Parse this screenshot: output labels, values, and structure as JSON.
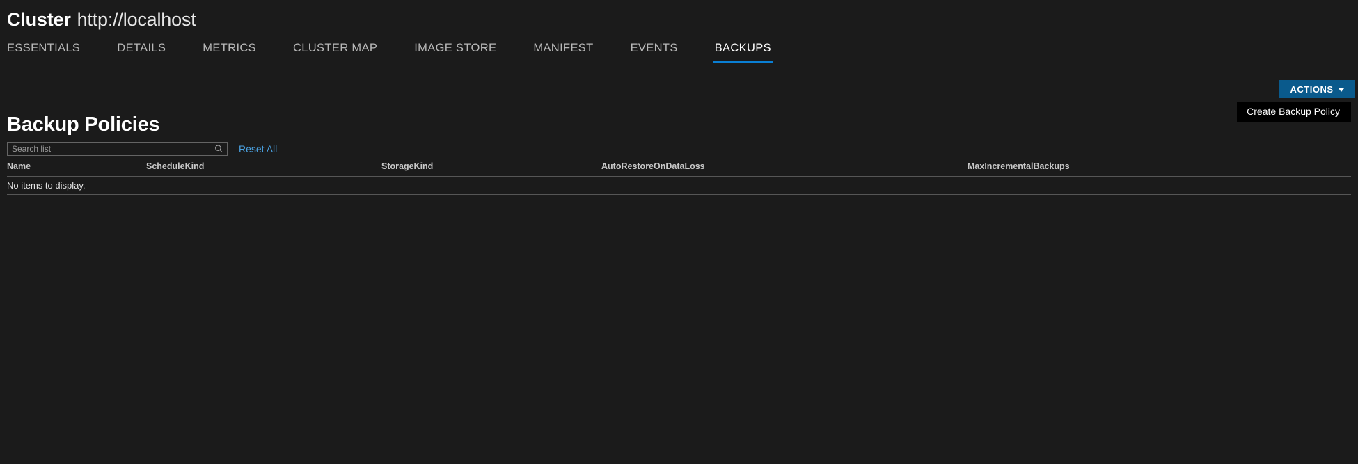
{
  "header": {
    "entity_type": "Cluster",
    "address": "http://localhost"
  },
  "tabs": [
    {
      "label": "ESSENTIALS",
      "active": false
    },
    {
      "label": "DETAILS",
      "active": false
    },
    {
      "label": "METRICS",
      "active": false
    },
    {
      "label": "CLUSTER MAP",
      "active": false
    },
    {
      "label": "IMAGE STORE",
      "active": false
    },
    {
      "label": "MANIFEST",
      "active": false
    },
    {
      "label": "EVENTS",
      "active": false
    },
    {
      "label": "BACKUPS",
      "active": true
    }
  ],
  "actions": {
    "button_label": "ACTIONS",
    "menu_items": [
      {
        "label": "Create Backup Policy"
      }
    ]
  },
  "section": {
    "title": "Backup Policies"
  },
  "filter": {
    "search_placeholder": "Search list",
    "search_value": "",
    "reset_label": "Reset All"
  },
  "table": {
    "columns": [
      "Name",
      "ScheduleKind",
      "StorageKind",
      "AutoRestoreOnDataLoss",
      "MaxIncrementalBackups"
    ],
    "rows": [],
    "empty_message": "No items to display."
  },
  "colors": {
    "background": "#1b1b1b",
    "accent_blue": "#0a7fd4",
    "button_blue": "#0a5a8c",
    "link_blue": "#4ba3e3",
    "menu_background": "#000000",
    "divider": "#565656"
  }
}
